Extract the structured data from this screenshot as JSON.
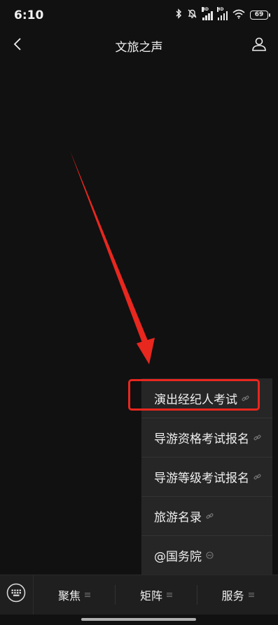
{
  "status": {
    "time": "6:10",
    "battery": "69",
    "icons": [
      "bluetooth-icon",
      "mute-bell-icon",
      "signal-hd-icon",
      "signal-hd-icon",
      "wifi-icon",
      "battery-icon"
    ]
  },
  "header": {
    "title": "文旅之声",
    "back_icon": "chevron-left-icon",
    "profile_icon": "person-icon"
  },
  "menu": {
    "items": [
      {
        "label": "演出经纪人考试",
        "icon": "link-icon",
        "highlighted": true
      },
      {
        "label": "导游资格考试报名",
        "icon": "link-icon"
      },
      {
        "label": "导游等级考试报名",
        "icon": "link-icon"
      },
      {
        "label": "旅游名录",
        "icon": "link-icon"
      },
      {
        "label": "@国务院",
        "icon": "mini-program-icon"
      }
    ]
  },
  "bottom_nav": {
    "keyboard_icon": "keyboard-icon",
    "tabs": [
      {
        "label": "聚焦",
        "icon": "menu-lines-icon"
      },
      {
        "label": "矩阵",
        "icon": "menu-lines-icon"
      },
      {
        "label": "服务",
        "icon": "menu-lines-icon"
      }
    ]
  },
  "colors": {
    "background": "#111111",
    "menu_background": "#262626",
    "highlight": "#e8271f",
    "text": "#f0f0f0"
  }
}
